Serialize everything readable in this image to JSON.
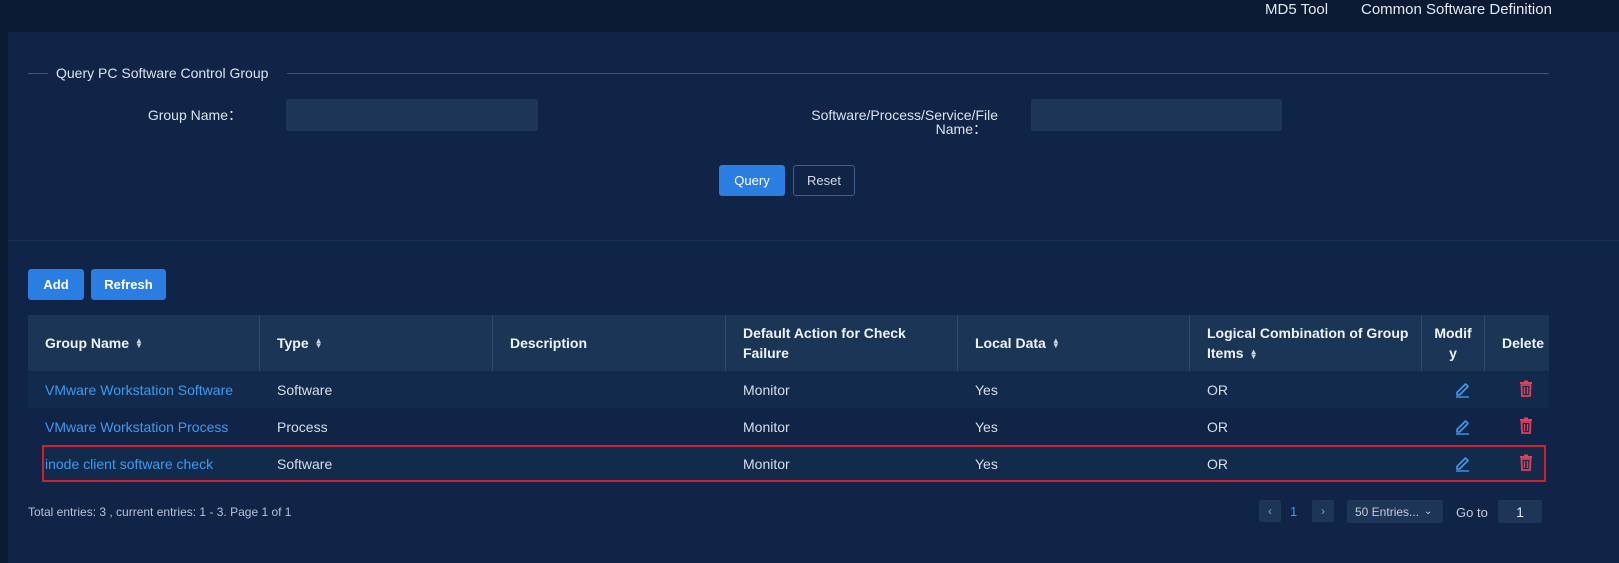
{
  "topnav": {
    "md5_tool": "MD5 Tool",
    "common_software": "Common Software Definition"
  },
  "query": {
    "title": "Query PC Software Control Group",
    "group_name_label": "Group Name：",
    "software_label_line1": "Software/Process/Service/File",
    "software_label_line2": "Name：",
    "group_name_value": "",
    "software_value": "",
    "query_button": "Query",
    "reset_button": "Reset"
  },
  "toolbar": {
    "add_button": "Add",
    "refresh_button": "Refresh"
  },
  "table": {
    "headers": {
      "group_name": "Group Name",
      "type": "Type",
      "description": "Description",
      "default_action_line1": "Default Action for Check",
      "default_action_line2": "Failure",
      "local_data": "Local Data",
      "logical_line1": "Logical Combination of Group",
      "logical_line2": "Items",
      "modify_line1": "Modif",
      "modify_line2": "y",
      "delete": "Delete"
    },
    "rows": [
      {
        "group_name": "VMware Workstation Software",
        "type": "Software",
        "description": "",
        "default_action": "Monitor",
        "local_data": "Yes",
        "logical": "OR"
      },
      {
        "group_name": "VMware Workstation Process",
        "type": "Process",
        "description": "",
        "default_action": "Monitor",
        "local_data": "Yes",
        "logical": "OR"
      },
      {
        "group_name": "inode client software check",
        "type": "Software",
        "description": "",
        "default_action": "Monitor",
        "local_data": "Yes",
        "logical": "OR"
      }
    ]
  },
  "footer": {
    "summary": "Total entries: 3 , current entries: 1 - 3. Page 1 of 1",
    "current_page": "1",
    "page_size": "50 Entries...",
    "goto_label": "Go to",
    "goto_value": "1"
  },
  "colors": {
    "accent": "#2a7de1",
    "link": "#3f9bf0",
    "delete": "#e0405a",
    "highlight": "#d0202a"
  },
  "icons": {
    "modify": "pencil-icon",
    "delete": "trash-icon",
    "sort": "sort-icon",
    "prev": "chevron-left-icon",
    "next": "chevron-right-icon",
    "dropdown": "chevron-down-icon"
  }
}
